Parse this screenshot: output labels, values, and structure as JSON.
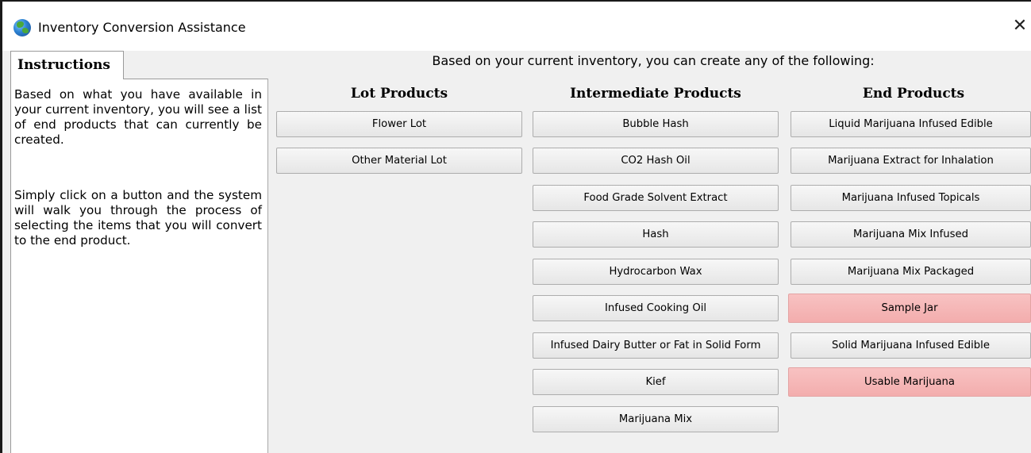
{
  "window": {
    "title": "Inventory Conversion Assistance",
    "close_glyph": "✕"
  },
  "instructions": {
    "tab_label": "Instructions",
    "paragraph_1": "Based on what you have available in your current inventory, you will see a list of end products that can currently be created.",
    "paragraph_2": "Simply click on a button and the system will walk you through the process of selecting the items that you will convert to the end product."
  },
  "header": "Based on your current inventory, you can create any of the following:",
  "columns": {
    "lot": {
      "heading": "Lot Products",
      "items": [
        "Flower Lot",
        "Other Material Lot"
      ]
    },
    "intermediate": {
      "heading": "Intermediate Products",
      "items": [
        "Bubble Hash",
        "CO2 Hash Oil",
        "Food Grade Solvent Extract",
        "Hash",
        "Hydrocarbon Wax",
        "Infused Cooking Oil",
        "Infused Dairy Butter or Fat in Solid Form",
        "Kief",
        "Marijuana Mix"
      ]
    },
    "end": {
      "heading": "End Products",
      "items": [
        "Liquid Marijuana Infused Edible",
        "Marijuana Extract for Inhalation",
        "Marijuana Infused Topicals",
        "Marijuana Mix Infused",
        "Marijuana Mix Packaged",
        "Sample Jar",
        "Solid Marijuana Infused Edible",
        "Usable Marijuana"
      ],
      "highlighted": [
        "Sample Jar",
        "Usable Marijuana"
      ]
    }
  },
  "colors": {
    "highlight": "#f5b8b8",
    "button": "#eaeaea",
    "panel_bg": "#f0f0f0"
  }
}
